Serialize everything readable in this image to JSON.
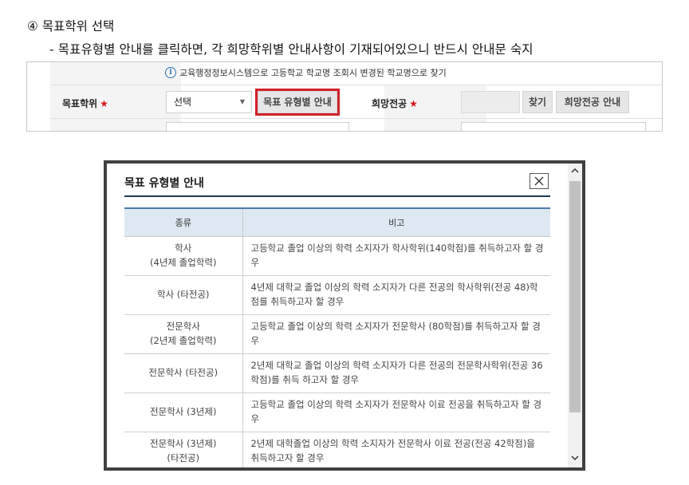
{
  "doc": {
    "step_title": "④ 목표학위 선택",
    "step_desc": "- 목표유형별 안내를 클릭하면, 각 희망학위별 안내사항이 기재되어있으니 반드시 안내문 숙지"
  },
  "form": {
    "info_text": "교육행정정보시스템으로 고등학교 학교명 조회시 변경된 학교명으로 찾기",
    "target_degree_label": "목표학위",
    "required_mark": "★",
    "select_value": "선택",
    "target_guide_button": "목표 유형별 안내",
    "desired_major_label": "희망전공",
    "find_button": "찾기",
    "major_guide_button": "희망전공 안내"
  },
  "modal": {
    "title": "목표 유형별 안내",
    "columns": [
      "종류",
      "비고"
    ],
    "rows": [
      {
        "type_line1": "학사",
        "type_line2": "(4년제 졸업학력)",
        "note": "고등학교 졸업 이상의 학력 소지자가 학사학위(140학점)를 취득하고자 할 경우"
      },
      {
        "type_line1": "학사 (타전공)",
        "type_line2": "",
        "note": "4년제 대학교 졸업 이상의 학력 소지자가 다른 전공의 학사학위(전공 48)학점를 취득하고자 할 경우"
      },
      {
        "type_line1": "전문학사",
        "type_line2": "(2년제 졸업학력)",
        "note": "고등학교 졸업 이상의 학력 소지자가 전문학사 (80학점)를 취득하고자 할 경우"
      },
      {
        "type_line1": "전문학사 (타전공)",
        "type_line2": "",
        "note": "2년제 대학교 졸업 이상의 학력 소지자가 다른 전공의 전문학사학위(전공 36학점)를 취득 하고자 할 경우"
      },
      {
        "type_line1": "전문학사 (3년제)",
        "type_line2": "",
        "note": "고등학교 졸업 이상의 학력 소지자가 전문학사 이료 전공을 취득하고자 할 경우"
      },
      {
        "type_line1": "전문학사 (3년제)",
        "type_line2": "(타전공)",
        "note": "2년제 대학졸업 이상의 학력 소지자가 전문학사 이료 전공(전공 42학점)을 취득하고자 할 경우"
      }
    ]
  },
  "icons": {
    "info": "info-circle-icon",
    "close": "close-x-icon",
    "caret": "caret-down-icon",
    "scroll_up": "chevron-up-icon",
    "scroll_down": "chevron-down-icon"
  },
  "colors": {
    "required": "#d4151e",
    "highlight": "#d4202a",
    "header_bg": "#dde8f3",
    "title_rule": "#1f3b55"
  }
}
